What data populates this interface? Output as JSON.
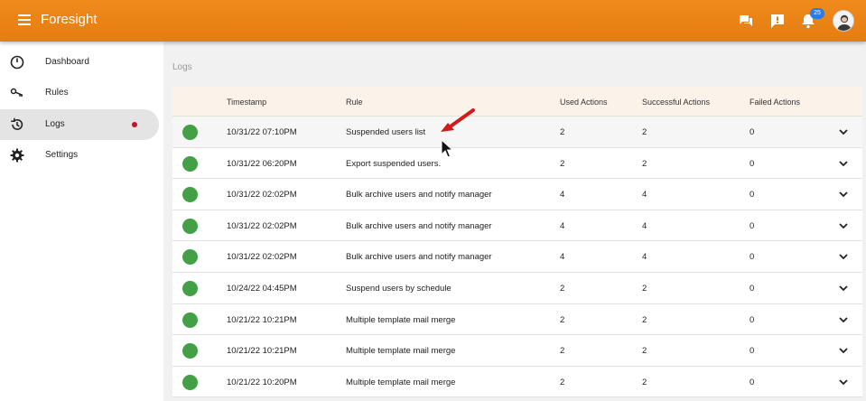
{
  "app": {
    "title": "Foresight",
    "notification_count": "25"
  },
  "sidebar": {
    "items": [
      {
        "label": "Dashboard",
        "icon": "dashboard-gauge-icon"
      },
      {
        "label": "Rules",
        "icon": "rules-key-icon"
      },
      {
        "label": "Logs",
        "icon": "history-icon"
      },
      {
        "label": "Settings",
        "icon": "gear-icon"
      }
    ],
    "active": "Logs"
  },
  "breadcrumb": "Logs",
  "table": {
    "headers": {
      "timestamp": "Timestamp",
      "rule": "Rule",
      "used": "Used Actions",
      "successful": "Successful Actions",
      "failed": "Failed Actions"
    },
    "rows": [
      {
        "timestamp": "10/31/22 07:10PM",
        "rule": "Suspended users list",
        "used": "2",
        "successful": "2",
        "failed": "0"
      },
      {
        "timestamp": "10/31/22 06:20PM",
        "rule": "Export suspended users.",
        "used": "2",
        "successful": "2",
        "failed": "0"
      },
      {
        "timestamp": "10/31/22 02:02PM",
        "rule": "Bulk archive users and notify manager",
        "used": "4",
        "successful": "4",
        "failed": "0"
      },
      {
        "timestamp": "10/31/22 02:02PM",
        "rule": "Bulk archive users and notify manager",
        "used": "4",
        "successful": "4",
        "failed": "0"
      },
      {
        "timestamp": "10/31/22 02:02PM",
        "rule": "Bulk archive users and notify manager",
        "used": "4",
        "successful": "4",
        "failed": "0"
      },
      {
        "timestamp": "10/24/22 04:45PM",
        "rule": "Suspend users by schedule",
        "used": "2",
        "successful": "2",
        "failed": "0"
      },
      {
        "timestamp": "10/21/22 10:21PM",
        "rule": "Multiple template mail merge",
        "used": "2",
        "successful": "2",
        "failed": "0"
      },
      {
        "timestamp": "10/21/22 10:21PM",
        "rule": "Multiple template mail merge",
        "used": "2",
        "successful": "2",
        "failed": "0"
      },
      {
        "timestamp": "10/21/22 10:20PM",
        "rule": "Multiple template mail merge",
        "used": "2",
        "successful": "2",
        "failed": "0"
      }
    ]
  },
  "colors": {
    "topbar": "#ec8418",
    "status_success": "#43a047",
    "active_dot": "#c0152a",
    "badge": "#2c7be5",
    "annotation_arrow": "#d11a1a"
  }
}
